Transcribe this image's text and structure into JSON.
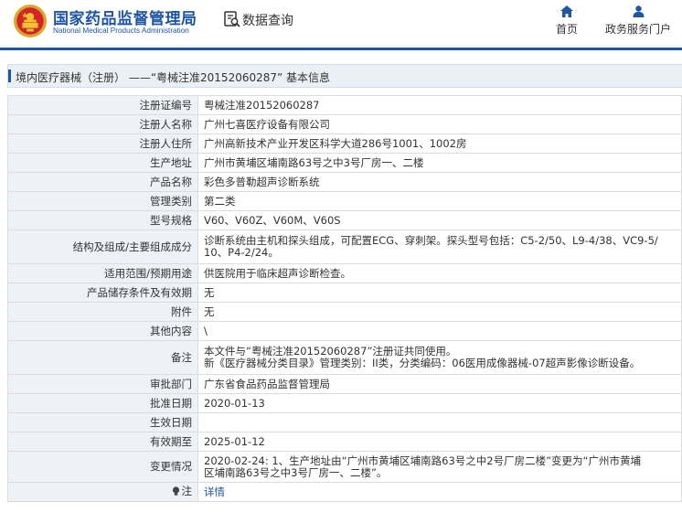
{
  "header": {
    "site_name_cn": "国家药品监督管理局",
    "site_name_en": "National Medical Products Administration",
    "query_label": "数据查询",
    "nav": [
      {
        "label": "首页",
        "icon": "home-icon"
      },
      {
        "label": "政务服务门户",
        "icon": "user-icon"
      }
    ]
  },
  "title_bar": "境内医疗器械（注册） ——“粤械注准20152060287” 基本信息",
  "colors": {
    "brand": "#1f56a3",
    "label_bg": "#eef1f5",
    "title_bg": "#eaf0f6",
    "border": "#dcdcdc"
  },
  "rows": [
    {
      "label": "注册证编号",
      "value": "粤械注准20152060287"
    },
    {
      "label": "注册人名称",
      "value": "广州七喜医疗设备有限公司"
    },
    {
      "label": "注册人住所",
      "value": "广州高新技术产业开发区科学大道286号1001、1002房"
    },
    {
      "label": "生产地址",
      "value": "广州市黄埔区埔南路63号之中3号厂房一、二楼"
    },
    {
      "label": "产品名称",
      "value": "彩色多普勒超声诊断系统"
    },
    {
      "label": "管理类别",
      "value": "第二类"
    },
    {
      "label": "型号规格",
      "value": "V60、V60Z、V60M、V60S"
    },
    {
      "label": "结构及组成/主要组成成分",
      "value_lines": [
        "诊断系统由主机和探头组成，可配置ECG、穿刺架。探头型号包括：C5-2/50、L9-4/38、VC9-5/",
        "10、P4-2/24。"
      ]
    },
    {
      "label": "适用范围/预期用途",
      "value": "供医院用于临床超声诊断检查。"
    },
    {
      "label": "产品储存条件及有效期",
      "value": "无"
    },
    {
      "label": "附件",
      "value": "无"
    },
    {
      "label": "其他内容",
      "value": "\\"
    },
    {
      "label": "备注",
      "value_lines": [
        "本文件与“粤械注准20152060287”注册证共同使用。",
        "新《医疗器械分类目录》管理类别：II类，分类编码：06医用成像器械-07超声影像诊断设备。"
      ]
    },
    {
      "label": "审批部门",
      "value": "广东省食品药品监督管理局"
    },
    {
      "label": "批准日期",
      "value": "2020-01-13"
    },
    {
      "label": "生效日期",
      "value": ""
    },
    {
      "label": "有效期至",
      "value": "2025-01-12"
    },
    {
      "label": "变更情况",
      "value_lines": [
        "2020-02-24: 1、生产地址由“广州市黄埔区埔南路63号之中2号厂房二楼”变更为“广州市黄埔",
        "区埔南路63号之中3号厂房一、二楼”。"
      ]
    },
    {
      "label": "注",
      "value": "详情"
    }
  ]
}
